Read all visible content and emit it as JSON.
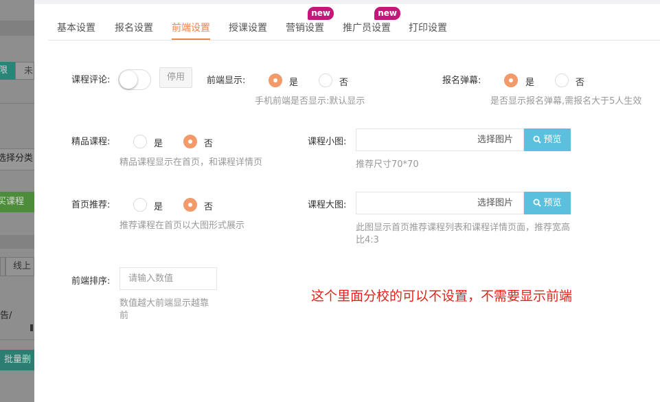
{
  "background": {
    "tab_active": "限",
    "tab_inactive": "未",
    "select_category": "选择分类",
    "buy_course": "买课程",
    "online": "线上",
    "slash_text": "告/",
    "bulk_delete": "批量删"
  },
  "tabs": [
    {
      "label": "基本设置"
    },
    {
      "label": "报名设置"
    },
    {
      "label": "前端设置"
    },
    {
      "label": "授课设置"
    },
    {
      "label": "营销设置",
      "badge": "new"
    },
    {
      "label": "推广员设置",
      "badge": "new"
    },
    {
      "label": "打印设置"
    }
  ],
  "active_tab": "前端设置",
  "form": {
    "comment": {
      "label": "课程评论:",
      "state": "停用",
      "enabled": false
    },
    "frontend_display": {
      "label": "前端显示:",
      "yes": "是",
      "no": "否",
      "selected": "是",
      "hint": "手机前端是否显示:默认显示"
    },
    "barrage": {
      "label": "报名弹幕:",
      "yes": "是",
      "no": "否",
      "selected": "是",
      "hint": "是否显示报名弹幕,需报名大于5人生效"
    },
    "featured": {
      "label": "精品课程:",
      "yes": "是",
      "no": "否",
      "selected": "否",
      "hint": "精品课程显示在首页，和课程详情页"
    },
    "small_image": {
      "label": "课程小图:",
      "value": "",
      "select_label": "选择图片",
      "preview_label": "预览",
      "hint": "推荐尺寸70*70"
    },
    "homepage_rec": {
      "label": "首页推荐:",
      "yes": "是",
      "no": "否",
      "selected": "否",
      "hint": "推荐课程在首页以大图形式展示"
    },
    "large_image": {
      "label": "课程大图:",
      "value": "",
      "select_label": "选择图片",
      "preview_label": "预览",
      "hint_line1": "此图显示首页推荐课程列表和课程详情页面，推荐宽高",
      "hint_line2": "比4:3"
    },
    "sort": {
      "label": "前端排序:",
      "placeholder": "请输入数值",
      "hint_line1": "数值越大前端显示越靠",
      "hint_line2": "前"
    }
  },
  "annotation": "这个里面分校的可以不设置，不需要显示前端",
  "colors": {
    "accent": "#f0834f",
    "radio_on": "#f39a6a",
    "preview": "#5bc0de",
    "badge": "#c2187a",
    "note": "#e2231a"
  }
}
